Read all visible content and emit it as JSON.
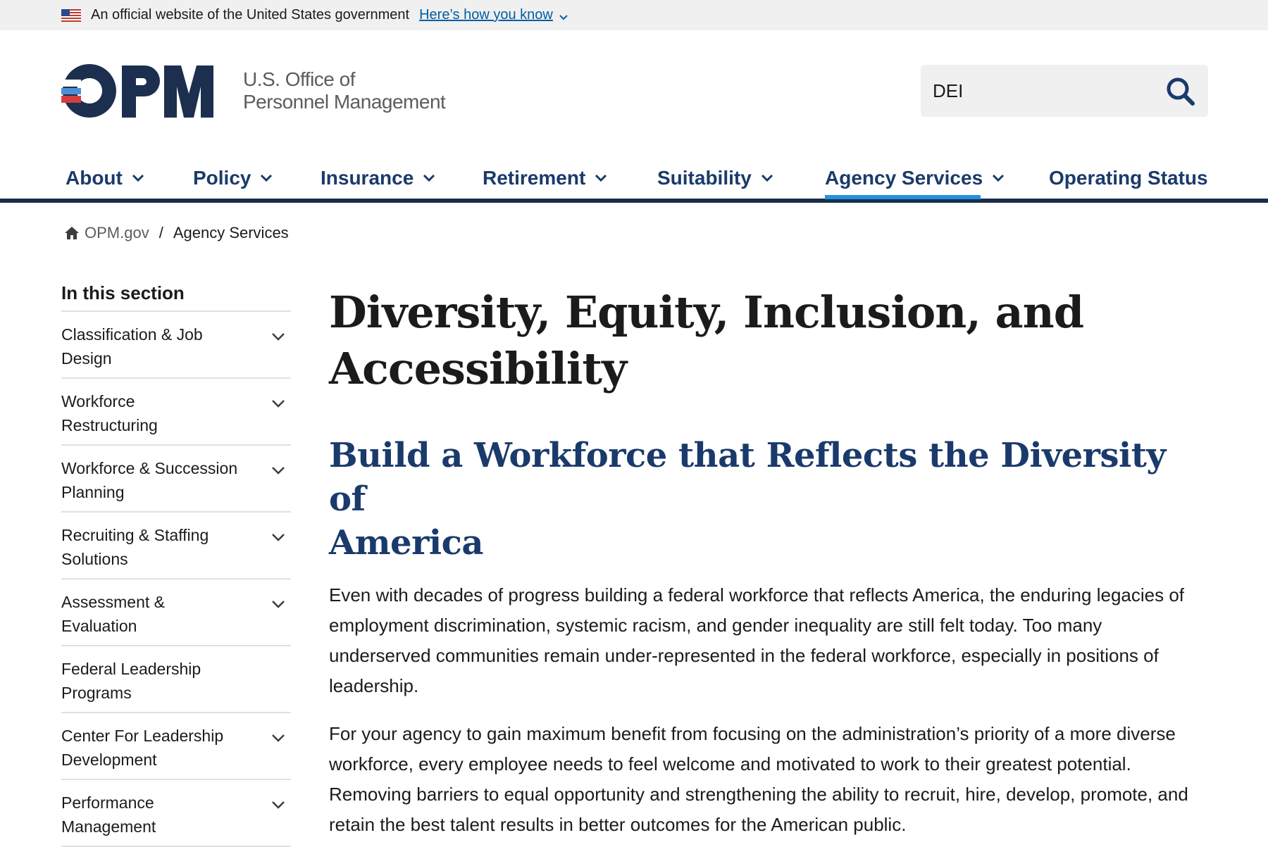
{
  "gov_banner": {
    "text": "An official website of the United States government",
    "link": "Here’s how you know"
  },
  "header": {
    "logo_text": "OPM",
    "logo_subtitle_line1": "U.S. Office of",
    "logo_subtitle_line2": "Personnel Management",
    "search": {
      "value": "DEI",
      "icon": "search-icon"
    }
  },
  "nav": {
    "items": [
      {
        "label": "About",
        "has_dropdown": true
      },
      {
        "label": "Policy",
        "has_dropdown": true
      },
      {
        "label": "Insurance",
        "has_dropdown": true
      },
      {
        "label": "Retirement",
        "has_dropdown": true
      },
      {
        "label": "Suitability",
        "has_dropdown": true
      },
      {
        "label": "Agency Services",
        "has_dropdown": true,
        "active": true
      },
      {
        "label": "Operating Status",
        "has_dropdown": false
      }
    ]
  },
  "breadcrumb": {
    "home": "OPM.gov",
    "separator": "/",
    "current": "Agency Services"
  },
  "sidebar": {
    "heading": "In this section",
    "items": [
      {
        "line1": "Classification & Job",
        "line2": "Design",
        "has_dropdown": true
      },
      {
        "line1": "Workforce",
        "line2": "Restructuring",
        "has_dropdown": true
      },
      {
        "line1": "Workforce & Succession",
        "line2": "Planning",
        "has_dropdown": true
      },
      {
        "line1": "Recruiting & Staffing",
        "line2": "Solutions",
        "has_dropdown": true
      },
      {
        "line1": "Assessment &",
        "line2": "Evaluation",
        "has_dropdown": true
      },
      {
        "line1": "Federal Leadership",
        "line2": "Programs",
        "has_dropdown": false
      },
      {
        "line1": "Center For Leadership",
        "line2": "Development",
        "has_dropdown": true
      },
      {
        "line1": "Performance",
        "line2": "Management",
        "has_dropdown": true
      }
    ]
  },
  "main": {
    "title_line1": "Diversity, Equity, Inclusion, and",
    "title_line2": "Accessibility",
    "subheading_line1": "Build a Workforce that Reflects the Diversity of",
    "subheading_line2": "America",
    "paragraph1": "Even with decades of progress building a federal workforce that reflects America, the enduring legacies of employment discrimination, systemic racism, and gender inequality are still felt today. Too many underserved communities remain under-represented in the federal workforce, especially in positions of leadership.",
    "paragraph2": "For your agency to gain maximum benefit from focusing on the administration’s priority of a more diverse workforce, every employee needs to feel welcome and motivated to work to their greatest potential. Removing barriers to equal opportunity and strengthening the ability to recruit, hire, develop, promote, and retain the best talent results in better outcomes for the American public."
  },
  "colors": {
    "navy": "#1a3a6b",
    "active_underline": "#2491e0",
    "logo_red": "#d63e3e",
    "logo_blue": "#4a90d9",
    "link_blue": "#005ea2"
  }
}
